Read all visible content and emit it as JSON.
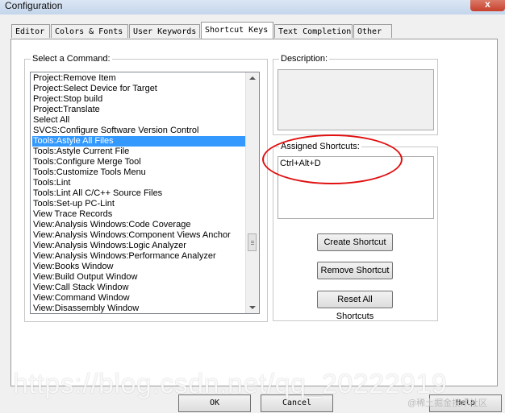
{
  "window": {
    "title": "Configuration",
    "close": "x"
  },
  "tabs": [
    {
      "label": "Editor"
    },
    {
      "label": "Colors & Fonts"
    },
    {
      "label": "User Keywords"
    },
    {
      "label": "Shortcut Keys",
      "active": true
    },
    {
      "label": "Text Completion"
    },
    {
      "label": "Other"
    }
  ],
  "commands": {
    "label": "Select a Command:",
    "items": [
      "Project:Remove Item",
      "Project:Select Device for Target",
      "Project:Stop build",
      "Project:Translate",
      "Select All",
      "SVCS:Configure Software Version Control",
      "Tools:Astyle All Files",
      "Tools:Astyle Current File",
      "Tools:Configure Merge Tool",
      "Tools:Customize Tools Menu",
      "Tools:Lint",
      "Tools:Lint All C/C++ Source Files",
      "Tools:Set-up PC-Lint",
      "View Trace Records",
      "View:Analysis Windows:Code Coverage",
      "View:Analysis Windows:Component Views Anchor",
      "View:Analysis Windows:Logic Analyzer",
      "View:Analysis Windows:Performance Analyzer",
      "View:Books Window",
      "View:Build Output Window",
      "View:Call Stack Window",
      "View:Command Window",
      "View:Disassembly Window"
    ],
    "selected_index": 6
  },
  "description": {
    "label": "Description:",
    "text": ""
  },
  "assigned": {
    "label": "Assigned Shortcuts:",
    "value": "Ctrl+Alt+D"
  },
  "buttons": {
    "create": "Create Shortcut",
    "remove": "Remove Shortcut",
    "reset": "Reset All Shortcuts"
  },
  "dialog_buttons": {
    "ok": "OK",
    "cancel": "Cancel",
    "help": "Help"
  },
  "watermark": {
    "main": "https://blog.csdn.net/qq_20222919",
    "secondary": "@稀土掘金技术社区"
  },
  "colors": {
    "selection": "#3399ff",
    "annotation": "#e01010"
  }
}
